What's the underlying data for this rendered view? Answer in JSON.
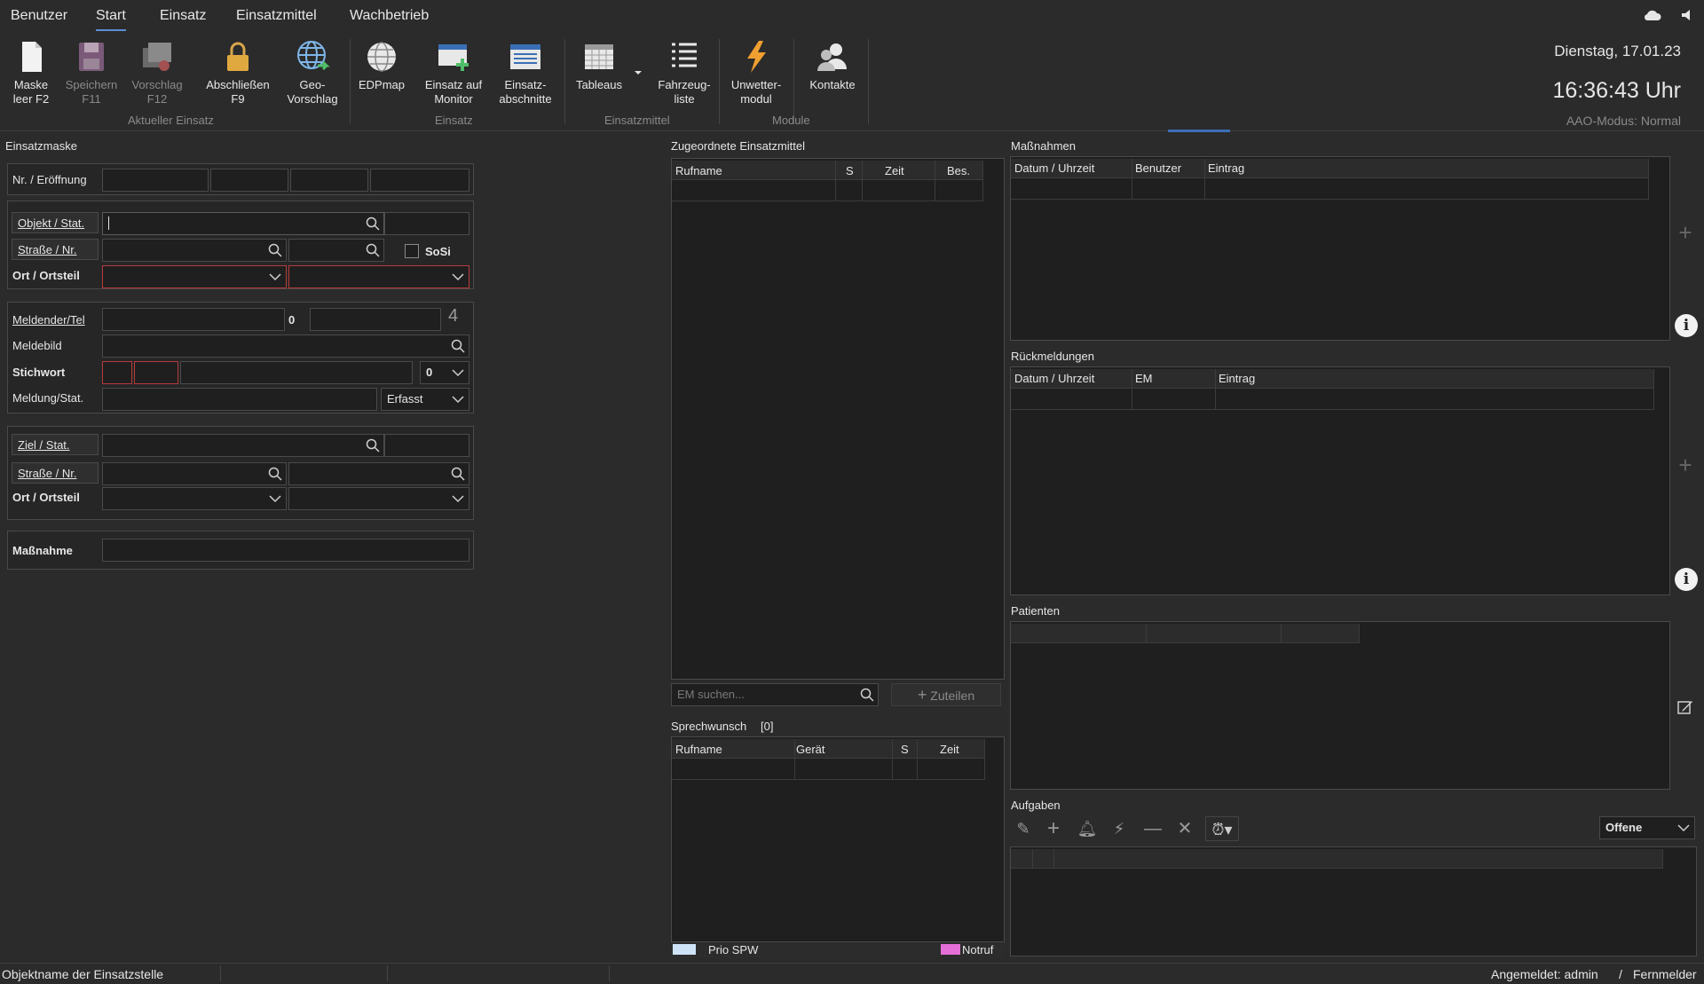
{
  "menu": {
    "items": [
      "Benutzer",
      "Start",
      "Einsatz",
      "Einsatzmittel",
      "Wachbetrieb"
    ]
  },
  "ribbon": {
    "buttons": [
      {
        "l1": "Maske",
        "l2": "leer F2"
      },
      {
        "l1": "Speichern",
        "l2": "F11"
      },
      {
        "l1": "Vorschlag",
        "l2": "F12"
      },
      {
        "l1": "Abschließen",
        "l2": "F9"
      },
      {
        "l1": "Geo-",
        "l2": "Vorschlag"
      },
      {
        "l1": "EDPmap",
        "l2": ""
      },
      {
        "l1": "Einsatz auf",
        "l2": "Monitor"
      },
      {
        "l1": "Einsatz-",
        "l2": "abschnitte"
      },
      {
        "l1": "Tableaus",
        "l2": ""
      },
      {
        "l1": "Fahrzeug-",
        "l2": "liste"
      },
      {
        "l1": "Unwetter-",
        "l2": "modul"
      },
      {
        "l1": "Kontakte",
        "l2": ""
      }
    ],
    "groups": [
      "Aktueller Einsatz",
      "Einsatz",
      "Einsatzmittel",
      "Module"
    ]
  },
  "header": {
    "date": "Dienstag, 17.01.23",
    "time": "16:36:43 Uhr",
    "aao": "AAO-Modus: Normal"
  },
  "einsatzmaske": {
    "title": "Einsatzmaske",
    "nr_label": "Nr. / Eröffnung",
    "objekt_label": "Objekt / Stat.",
    "strasse_label": "Straße / Nr.",
    "sosi_label": "SoSi",
    "ort_label": "Ort / Ortsteil",
    "meldender_label": "Meldender/Tel",
    "meldender_count": "0",
    "meldender_right": "4",
    "meldebild_label": "Meldebild",
    "stichwort_label": "Stichwort",
    "stichwort_value": "0",
    "meldung_label": "Meldung/Stat.",
    "meldung_status": "Erfasst",
    "ziel_label": "Ziel / Stat.",
    "ziel_strasse_label": "Straße / Nr.",
    "ziel_ort_label": "Ort / Ortsteil",
    "massnahme_label": "Maßnahme"
  },
  "einsatzmittel": {
    "title": "Zugeordnete Einsatzmittel",
    "columns": [
      "Rufname",
      "S",
      "Zeit",
      "Bes."
    ],
    "search_placeholder": "EM suchen...",
    "assign_label": "Zuteilen"
  },
  "sprechwunsch": {
    "title": "Sprechwunsch",
    "count": "[0]",
    "columns": [
      "Rufname",
      "Gerät",
      "S",
      "Zeit"
    ],
    "legend_prio": "Prio SPW",
    "legend_notruf": "Notruf",
    "legend_prio_color": "#cfe3f7",
    "legend_notruf_color": "#e46fd6"
  },
  "massnahmen": {
    "title": "Maßnahmen",
    "columns": [
      "Datum / Uhrzeit",
      "Benutzer",
      "Eintrag"
    ]
  },
  "rueckmeldungen": {
    "title": "Rückmeldungen",
    "columns": [
      "Datum / Uhrzeit",
      "EM",
      "Eintrag"
    ]
  },
  "patienten": {
    "title": "Patienten"
  },
  "aufgaben": {
    "title": "Aufgaben",
    "filter": "Offene"
  },
  "status": {
    "left": "Objektname der Einsatzstelle",
    "user": "Angemeldet: admin",
    "sep": "/",
    "role": "Fernmelder"
  }
}
